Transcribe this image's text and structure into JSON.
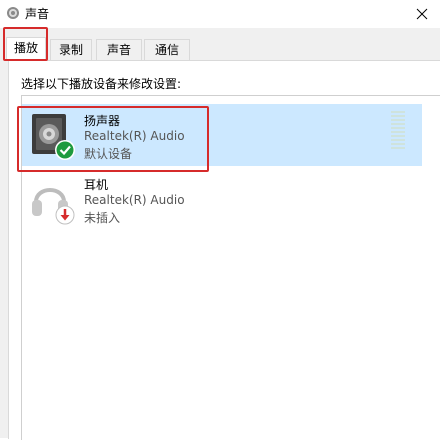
{
  "window": {
    "title": "声音",
    "close_icon": "✕"
  },
  "tabs": [
    {
      "label": "播放",
      "active": true
    },
    {
      "label": "录制",
      "active": false
    },
    {
      "label": "声音",
      "active": false
    },
    {
      "label": "通信",
      "active": false
    }
  ],
  "instruction": "选择以下播放设备来修改设置:",
  "devices": [
    {
      "name": "扬声器",
      "driver": "Realtek(R) Audio",
      "status": "默认设备",
      "icon": "speaker-icon",
      "badge": "check-badge-icon",
      "badge_color": "#1e9a3e",
      "selected": true
    },
    {
      "name": "耳机",
      "driver": "Realtek(R) Audio",
      "status": "未插入",
      "icon": "headphones-icon",
      "badge": "down-arrow-badge-icon",
      "badge_color": "#d62b2b",
      "selected": false
    }
  ],
  "colors": {
    "highlight_red": "#d62b2b",
    "selection_blue": "#cce8ff",
    "level_meter": "#cfe3dd"
  }
}
